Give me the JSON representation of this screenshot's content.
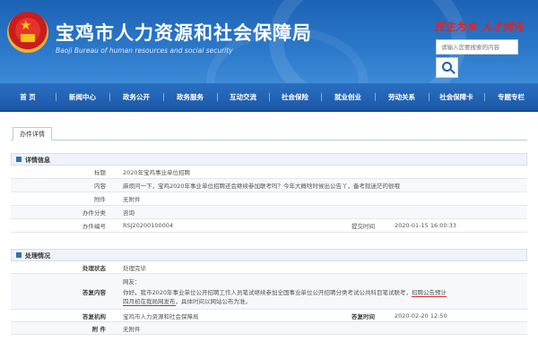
{
  "header": {
    "title": "宝鸡市人力资源和社会保障局",
    "subtitle": "Baoji Bureau of human resources and social security",
    "slogan": "民生为本 人才优先",
    "search_placeholder": "请输入您要搜索的内容",
    "colors": {
      "bar": "#1d63b5",
      "slogan": "#d7262e"
    }
  },
  "nav": {
    "items": [
      "首 页",
      "新闻中心",
      "政务公开",
      "政务服务",
      "互动交流",
      "社会保险",
      "就业创业",
      "劳动关系",
      "社会保障卡",
      "专题专栏"
    ]
  },
  "tab": {
    "label": "办件详情"
  },
  "detail": {
    "section_title": "详情信息",
    "rows": [
      {
        "label": "标题",
        "value": "2020年宝鸡事业单位招聘"
      },
      {
        "label": "内容",
        "value": "麻烦问一下，宝鸡2020年事业单位招聘还会继续参加联考吗？今年大概啥时候出公告丫，备考就迷茫的很哦"
      },
      {
        "label": "附件",
        "value": "无附件"
      },
      {
        "label": "办件分类",
        "value": "咨询"
      },
      {
        "label": "办件编号",
        "value": "RSJ20200100004",
        "label2": "提交时间",
        "value2": "2020-01-15 16:00:33"
      }
    ]
  },
  "process": {
    "section_title": "处理情况",
    "status_label": "处理状态",
    "status_value": "处理完毕",
    "reply_label": "答复内容",
    "reply_greeting": "网友：",
    "reply_line2_a": "你好，我市2020年事业单位公开招聘工作人员笔试继续参加全国事业单位公开招聘分类考试公共科目笔试联考，",
    "reply_line2_b": "招聘公告预计",
    "reply_line3_a": "四月初在我局网发布",
    "reply_line3_b": "，具体时间以网站公布为准。",
    "org_label": "答复机构",
    "org_value": "宝鸡市人力资源和社会保障局",
    "time_label": "答复时间",
    "time_value": "2020-02-20 12:50",
    "attach_label": "附 件",
    "attach_value": "无附件"
  }
}
